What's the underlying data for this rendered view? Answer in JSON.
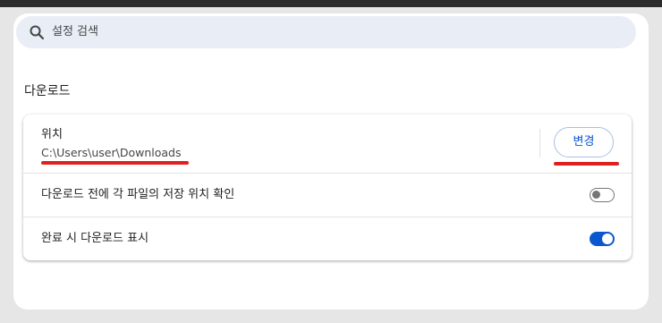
{
  "search": {
    "placeholder": "설정 검색",
    "icon": "search-icon"
  },
  "section": {
    "title": "다운로드"
  },
  "location": {
    "label": "위치",
    "path": "C:\\Users\\user\\Downloads",
    "change_button": "변경"
  },
  "settings": [
    {
      "label": "다운로드 전에 각 파일의 저장 위치 확인",
      "enabled": false
    },
    {
      "label": "완료 시 다운로드 표시",
      "enabled": true
    }
  ],
  "colors": {
    "accent": "#0b57d0",
    "annotation": "#e02020",
    "panel": "#ffffff",
    "search_bg": "#e9eef6"
  }
}
